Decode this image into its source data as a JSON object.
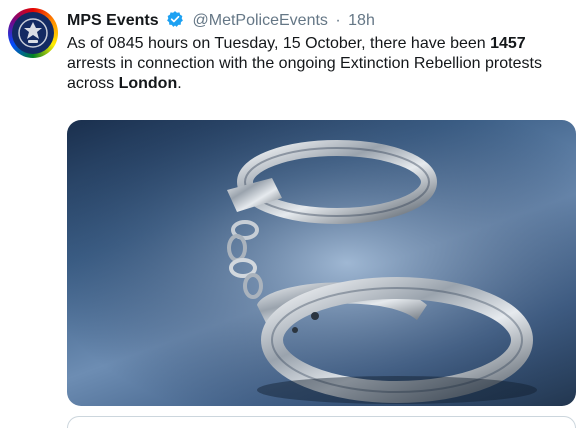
{
  "tweet": {
    "avatar_icon": "metropolitan-police-crest-icon",
    "display_name": "MPS Events",
    "verified_icon": "verified-badge-icon",
    "handle": "@MetPoliceEvents",
    "separator": "·",
    "timestamp": "18h",
    "text": {
      "part1": "As of 0845 hours on Tuesday, 15 October, there have been ",
      "bold1": "1457",
      "part2": " arrests in connection with the ongoing Extinction Rebellion protests across ",
      "bold2": "London",
      "part3": "."
    },
    "media": {
      "icon": "handcuffs-photo"
    }
  },
  "colors": {
    "text_primary": "#14171a",
    "text_secondary": "#657786",
    "verified_blue": "#1da1f2",
    "border": "#ccd6dd"
  }
}
